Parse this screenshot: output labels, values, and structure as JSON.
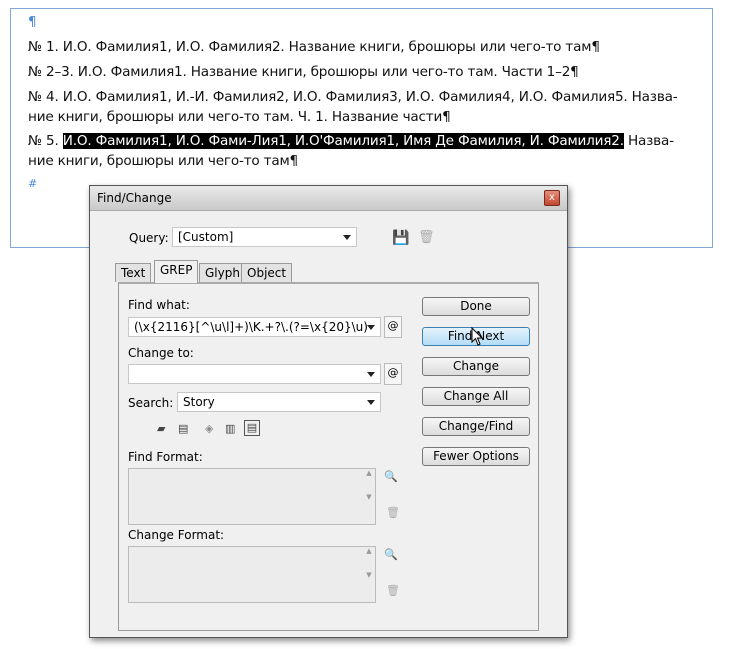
{
  "document": {
    "lines": [
      "¶",
      "№ 1. И.О. Фамилия1, И.О. Фамилия2. Название книги, брошюры или чего-то там¶",
      "№ 2–3. И.О. Фамилия1. Название книги, брошюры или чего-то там. Части 1–2¶",
      "№ 4. И.О. Фамилия1, И.-И. Фамилия2, И.О. Фамилия3, И.О. Фамилия4, И.О. Фамилия5. Назва-",
      "ние книги, брошюры или чего-то там. Ч. 1. Название части¶",
      "ние книги, брошюры или чего-то там¶",
      "#"
    ],
    "line5_prefix": "№ 5. ",
    "line5_selected": "И.О. Фамилия1, И.О. Фами-Лия1, И.О'Фамилия1, Имя Де Фамилия, И. Фамилия2.",
    "line5_suffix": " Назва-"
  },
  "dialog": {
    "title": "Find/Change",
    "close": "x",
    "query_label": "Query:",
    "query_value": "[Custom]",
    "tabs": [
      "Text",
      "GREP",
      "Glyph",
      "Object"
    ],
    "find_label": "Find what:",
    "find_value": "(\\x{2116}[^\\u\\l]+)\\K.+?\\.(?=\\x{20}\\u)",
    "change_label": "Change to:",
    "change_value": "",
    "search_label": "Search:",
    "search_value": "Story",
    "find_format_label": "Find Format:",
    "change_format_label": "Change Format:",
    "buttons": [
      "Done",
      "Find Next",
      "Change",
      "Change All",
      "Change/Find",
      "Fewer Options"
    ],
    "at_symbol": "@"
  }
}
